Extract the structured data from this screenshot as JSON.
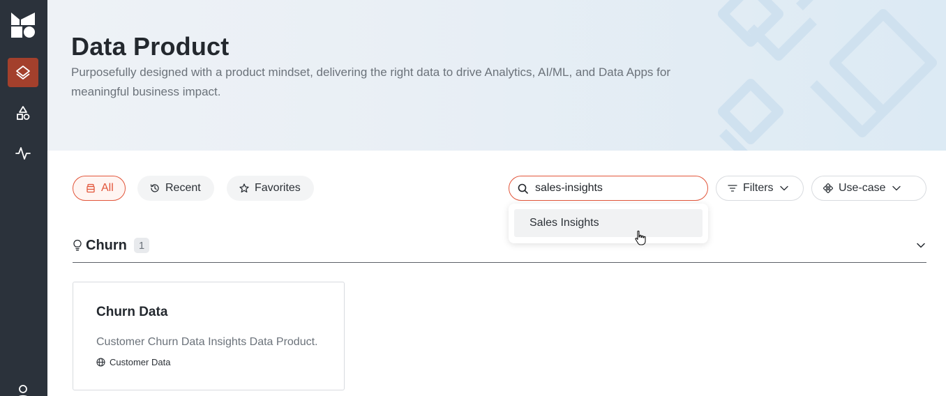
{
  "hero": {
    "title": "Data Product",
    "description": "Purposefully designed with a product mindset, delivering the right data to drive Analytics, AI/ML, and Data Apps for meaningful business impact."
  },
  "tabs": [
    {
      "label": "All",
      "icon": "bucket-icon",
      "active": true
    },
    {
      "label": "Recent",
      "icon": "history-icon",
      "active": false
    },
    {
      "label": "Favorites",
      "icon": "star-icon",
      "active": false
    }
  ],
  "search": {
    "value": "sales-insights",
    "suggestions": [
      "Sales Insights"
    ]
  },
  "filters": {
    "label": "Filters",
    "icon": "filter-icon"
  },
  "usecase": {
    "label": "Use-case",
    "icon": "usecase-icon"
  },
  "section": {
    "title": "Churn",
    "count": "1",
    "icon": "lightbulb-icon"
  },
  "cards": [
    {
      "title": "Churn Data",
      "description": "Customer Churn Data Insights Data Product.",
      "tag": "Customer Data",
      "tag_icon": "globe-icon"
    }
  ],
  "colors": {
    "accent": "#e2553a",
    "sidebar": "#2b323b",
    "sidebar_active": "#a3402c"
  }
}
